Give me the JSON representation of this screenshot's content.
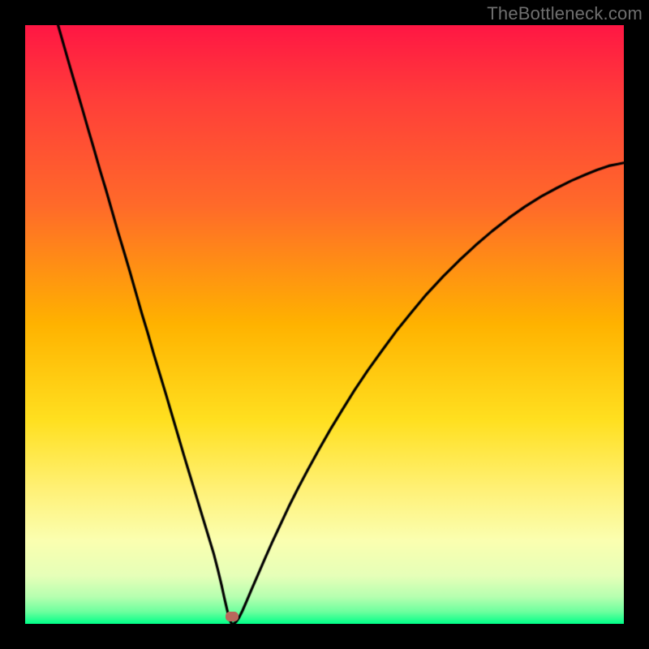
{
  "watermark": "TheBottleneck.com",
  "chart_data": {
    "type": "line",
    "title": "",
    "xlabel": "",
    "ylabel": "",
    "xlim": [
      0,
      1
    ],
    "ylim": [
      0,
      1
    ],
    "notch": {
      "x": 0.345,
      "y": 0.0
    },
    "marker": {
      "x": 0.345,
      "y": 0.012,
      "color": "#b9675c"
    },
    "left_start": {
      "x": 0.055,
      "y": 1.0
    },
    "right_end": {
      "x": 1.0,
      "y": 0.77
    },
    "gradient_stops": [
      {
        "pos": 0.0,
        "color": "#ff1744"
      },
      {
        "pos": 0.12,
        "color": "#ff3d3a"
      },
      {
        "pos": 0.3,
        "color": "#ff6a2a"
      },
      {
        "pos": 0.5,
        "color": "#ffb300"
      },
      {
        "pos": 0.66,
        "color": "#ffe020"
      },
      {
        "pos": 0.78,
        "color": "#fff27a"
      },
      {
        "pos": 0.86,
        "color": "#fbffb0"
      },
      {
        "pos": 0.92,
        "color": "#e6ffb8"
      },
      {
        "pos": 0.955,
        "color": "#b6ffb0"
      },
      {
        "pos": 0.98,
        "color": "#6cff9e"
      },
      {
        "pos": 1.0,
        "color": "#00ff88"
      }
    ],
    "series": [
      {
        "name": "bottleneck-curve",
        "points": [
          {
            "x": 0.055,
            "y": 1.0
          },
          {
            "x": 0.065,
            "y": 0.965
          },
          {
            "x": 0.075,
            "y": 0.93
          },
          {
            "x": 0.085,
            "y": 0.896
          },
          {
            "x": 0.095,
            "y": 0.862
          },
          {
            "x": 0.105,
            "y": 0.827
          },
          {
            "x": 0.115,
            "y": 0.793
          },
          {
            "x": 0.125,
            "y": 0.758
          },
          {
            "x": 0.135,
            "y": 0.725
          },
          {
            "x": 0.145,
            "y": 0.69
          },
          {
            "x": 0.155,
            "y": 0.655
          },
          {
            "x": 0.165,
            "y": 0.622
          },
          {
            "x": 0.175,
            "y": 0.588
          },
          {
            "x": 0.185,
            "y": 0.553
          },
          {
            "x": 0.195,
            "y": 0.518
          },
          {
            "x": 0.205,
            "y": 0.485
          },
          {
            "x": 0.215,
            "y": 0.45
          },
          {
            "x": 0.225,
            "y": 0.417
          },
          {
            "x": 0.235,
            "y": 0.384
          },
          {
            "x": 0.245,
            "y": 0.35
          },
          {
            "x": 0.255,
            "y": 0.316
          },
          {
            "x": 0.265,
            "y": 0.282
          },
          {
            "x": 0.275,
            "y": 0.249
          },
          {
            "x": 0.285,
            "y": 0.216
          },
          {
            "x": 0.295,
            "y": 0.183
          },
          {
            "x": 0.305,
            "y": 0.15
          },
          {
            "x": 0.315,
            "y": 0.117
          },
          {
            "x": 0.322,
            "y": 0.09
          },
          {
            "x": 0.328,
            "y": 0.065
          },
          {
            "x": 0.333,
            "y": 0.042
          },
          {
            "x": 0.337,
            "y": 0.025
          },
          {
            "x": 0.34,
            "y": 0.012
          },
          {
            "x": 0.343,
            "y": 0.004
          },
          {
            "x": 0.345,
            "y": 0.0
          },
          {
            "x": 0.348,
            "y": 0.0
          },
          {
            "x": 0.352,
            "y": 0.003
          },
          {
            "x": 0.357,
            "y": 0.01
          },
          {
            "x": 0.363,
            "y": 0.022
          },
          {
            "x": 0.37,
            "y": 0.038
          },
          {
            "x": 0.378,
            "y": 0.057
          },
          {
            "x": 0.388,
            "y": 0.08
          },
          {
            "x": 0.4,
            "y": 0.108
          },
          {
            "x": 0.412,
            "y": 0.135
          },
          {
            "x": 0.425,
            "y": 0.163
          },
          {
            "x": 0.44,
            "y": 0.195
          },
          {
            "x": 0.455,
            "y": 0.225
          },
          {
            "x": 0.472,
            "y": 0.257
          },
          {
            "x": 0.49,
            "y": 0.29
          },
          {
            "x": 0.51,
            "y": 0.325
          },
          {
            "x": 0.53,
            "y": 0.358
          },
          {
            "x": 0.55,
            "y": 0.39
          },
          {
            "x": 0.572,
            "y": 0.423
          },
          {
            "x": 0.595,
            "y": 0.455
          },
          {
            "x": 0.62,
            "y": 0.489
          },
          {
            "x": 0.645,
            "y": 0.52
          },
          {
            "x": 0.67,
            "y": 0.55
          },
          {
            "x": 0.698,
            "y": 0.58
          },
          {
            "x": 0.725,
            "y": 0.607
          },
          {
            "x": 0.752,
            "y": 0.632
          },
          {
            "x": 0.78,
            "y": 0.656
          },
          {
            "x": 0.808,
            "y": 0.678
          },
          {
            "x": 0.835,
            "y": 0.697
          },
          {
            "x": 0.862,
            "y": 0.714
          },
          {
            "x": 0.888,
            "y": 0.728
          },
          {
            "x": 0.912,
            "y": 0.74
          },
          {
            "x": 0.935,
            "y": 0.75
          },
          {
            "x": 0.955,
            "y": 0.758
          },
          {
            "x": 0.975,
            "y": 0.765
          },
          {
            "x": 0.99,
            "y": 0.768
          },
          {
            "x": 1.0,
            "y": 0.77
          }
        ]
      }
    ]
  }
}
